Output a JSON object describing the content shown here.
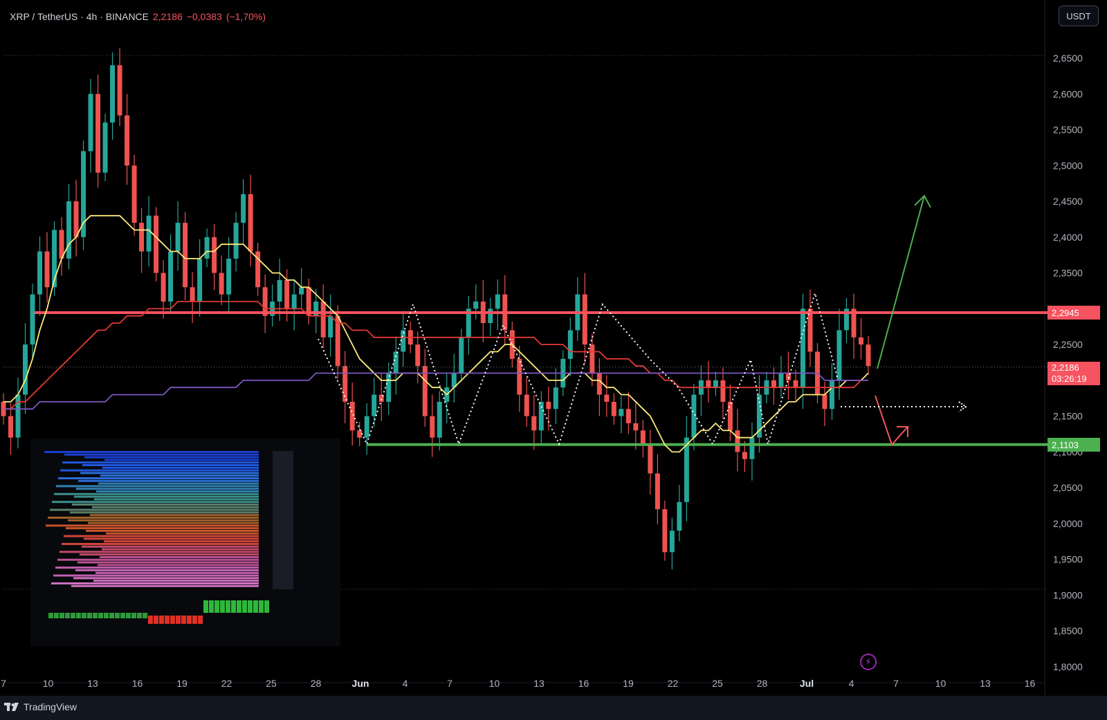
{
  "header": {
    "symbol": "XRP / TetherUS · 4h · BINANCE",
    "last": "2,2186",
    "change": "−0,0383",
    "change_pct": "(−1,70%)"
  },
  "currency": "USDT",
  "branding": "TradingView",
  "levels": {
    "resistance": {
      "value": 2.2945,
      "label": "2,2945",
      "color": "#f7525f"
    },
    "support": {
      "value": 2.1103,
      "label": "2,1103",
      "color": "#4caf50"
    },
    "last": {
      "value": 2.2186,
      "label": "2,2186",
      "countdown": "03:26:19",
      "color": "#f7525f"
    }
  },
  "colors": {
    "bull": "#26a69a",
    "bear": "#ef5350",
    "ma_fast": "#ffeb7a",
    "ma_mid": "#e53935",
    "ma_slow": "#7e57c2"
  },
  "chart_data": {
    "type": "line",
    "title": "XRP / TetherUS · 4h · BINANCE",
    "ylim": [
      1.8,
      2.65
    ],
    "y_ticks": [
      2.65,
      2.6,
      2.55,
      2.5,
      2.45,
      2.4,
      2.35,
      2.3,
      2.25,
      2.2,
      2.15,
      2.1,
      2.05,
      2.0,
      1.95,
      1.9,
      1.85,
      1.8
    ],
    "y_tick_labels": [
      "2,6500",
      "2,6000",
      "2,5500",
      "2,5000",
      "2,4500",
      "2,4000",
      "2,3500",
      "2,3000",
      "2,2500",
      "2,2000",
      "2,1500",
      "2,1000",
      "2,0500",
      "2,0000",
      "1,9500",
      "1,9000",
      "1,8500",
      "1,8000"
    ],
    "x_ticks": [
      "7",
      "10",
      "13",
      "16",
      "19",
      "22",
      "25",
      "28",
      "Jun",
      "4",
      "7",
      "10",
      "13",
      "16",
      "19",
      "22",
      "25",
      "28",
      "Jul",
      "4",
      "7",
      "10",
      "13",
      "16"
    ],
    "grid": false,
    "legend": "none",
    "series": [
      {
        "values": [
          2.15,
          2.12,
          2.18,
          2.25,
          2.32,
          2.38,
          2.33,
          2.41,
          2.37,
          2.45,
          2.4,
          2.52,
          2.6,
          2.49,
          2.56,
          2.64,
          2.57,
          2.5,
          2.42,
          2.38,
          2.43,
          2.35,
          2.31,
          2.38,
          2.42,
          2.33,
          2.31,
          2.37,
          2.4,
          2.35,
          2.32,
          2.37,
          2.42,
          2.46,
          2.38,
          2.33,
          2.29,
          2.31,
          2.34,
          2.3,
          2.32,
          2.33,
          2.29,
          2.31,
          2.26,
          2.29,
          2.22,
          2.17,
          2.13,
          2.12,
          2.15,
          2.18,
          2.17,
          2.21,
          2.24,
          2.27,
          2.25,
          2.22,
          2.15,
          2.12,
          2.17,
          2.19,
          2.21,
          2.26,
          2.3,
          2.31,
          2.28,
          2.3,
          2.32,
          2.27,
          2.23,
          2.18,
          2.15,
          2.13,
          2.17,
          2.16,
          2.19,
          2.23,
          2.27,
          2.32,
          2.25,
          2.21,
          2.18,
          2.17,
          2.15,
          2.16,
          2.14,
          2.13,
          2.11,
          2.07,
          2.02,
          1.96,
          1.99,
          2.03,
          2.12,
          2.18,
          2.2,
          2.19,
          2.2,
          2.17,
          2.13,
          2.1,
          2.09,
          2.12,
          2.18,
          2.2,
          2.19,
          2.21,
          2.2,
          2.19,
          2.3,
          2.24,
          2.18,
          2.16,
          2.2,
          2.27,
          2.3,
          2.26,
          2.25,
          2.22
        ]
      },
      {
        "values": [
          2.17,
          2.17,
          2.18,
          2.2,
          2.23,
          2.27,
          2.3,
          2.34,
          2.37,
          2.39,
          2.4,
          2.42,
          2.43,
          2.43,
          2.43,
          2.43,
          2.43,
          2.42,
          2.41,
          2.41,
          2.41,
          2.4,
          2.39,
          2.38,
          2.38,
          2.37,
          2.37,
          2.37,
          2.38,
          2.38,
          2.39,
          2.39,
          2.39,
          2.39,
          2.38,
          2.37,
          2.36,
          2.35,
          2.35,
          2.34,
          2.34,
          2.33,
          2.33,
          2.32,
          2.31,
          2.3,
          2.29,
          2.27,
          2.25,
          2.23,
          2.22,
          2.21,
          2.2,
          2.2,
          2.2,
          2.21,
          2.21,
          2.21,
          2.2,
          2.19,
          2.19,
          2.18,
          2.19,
          2.2,
          2.21,
          2.22,
          2.23,
          2.24,
          2.24,
          2.25,
          2.25,
          2.24,
          2.23,
          2.22,
          2.21,
          2.2,
          2.2,
          2.2,
          2.21,
          2.21,
          2.21,
          2.2,
          2.2,
          2.19,
          2.19,
          2.18,
          2.18,
          2.17,
          2.16,
          2.15,
          2.13,
          2.11,
          2.1,
          2.1,
          2.11,
          2.12,
          2.13,
          2.13,
          2.14,
          2.13,
          2.13,
          2.12,
          2.12,
          2.12,
          2.13,
          2.14,
          2.15,
          2.16,
          2.17,
          2.17,
          2.18,
          2.18,
          2.18,
          2.18,
          2.19,
          2.19,
          2.2,
          2.2,
          2.2,
          2.21
        ]
      },
      {
        "values": [
          2.16,
          2.16,
          2.17,
          2.17,
          2.18,
          2.19,
          2.2,
          2.21,
          2.22,
          2.23,
          2.24,
          2.25,
          2.26,
          2.27,
          2.27,
          2.28,
          2.28,
          2.29,
          2.29,
          2.29,
          2.3,
          2.3,
          2.3,
          2.3,
          2.31,
          2.31,
          2.31,
          2.31,
          2.31,
          2.31,
          2.31,
          2.31,
          2.31,
          2.31,
          2.31,
          2.31,
          2.3,
          2.3,
          2.3,
          2.3,
          2.3,
          2.3,
          2.29,
          2.29,
          2.29,
          2.29,
          2.28,
          2.28,
          2.27,
          2.27,
          2.27,
          2.26,
          2.26,
          2.26,
          2.26,
          2.26,
          2.26,
          2.26,
          2.26,
          2.26,
          2.26,
          2.26,
          2.26,
          2.26,
          2.26,
          2.26,
          2.26,
          2.26,
          2.26,
          2.26,
          2.26,
          2.26,
          2.26,
          2.26,
          2.25,
          2.25,
          2.25,
          2.25,
          2.24,
          2.24,
          2.24,
          2.24,
          2.24,
          2.23,
          2.23,
          2.23,
          2.23,
          2.22,
          2.22,
          2.21,
          2.21,
          2.2,
          2.2,
          2.19,
          2.19,
          2.19,
          2.19,
          2.19,
          2.19,
          2.19,
          2.19,
          2.19,
          2.19,
          2.19,
          2.19,
          2.19,
          2.19,
          2.19,
          2.19,
          2.19,
          2.19,
          2.19,
          2.19,
          2.19,
          2.19,
          2.19,
          2.19,
          2.19,
          2.2,
          2.2
        ]
      },
      {
        "values": [
          2.16,
          2.16,
          2.16,
          2.16,
          2.16,
          2.17,
          2.17,
          2.17,
          2.17,
          2.17,
          2.17,
          2.17,
          2.17,
          2.17,
          2.17,
          2.18,
          2.18,
          2.18,
          2.18,
          2.18,
          2.18,
          2.18,
          2.18,
          2.19,
          2.19,
          2.19,
          2.19,
          2.19,
          2.19,
          2.19,
          2.19,
          2.19,
          2.19,
          2.2,
          2.2,
          2.2,
          2.2,
          2.2,
          2.2,
          2.2,
          2.2,
          2.2,
          2.2,
          2.21,
          2.21,
          2.21,
          2.21,
          2.21,
          2.21,
          2.21,
          2.21,
          2.21,
          2.21,
          2.21,
          2.21,
          2.21,
          2.21,
          2.21,
          2.21,
          2.21,
          2.21,
          2.21,
          2.21,
          2.21,
          2.21,
          2.21,
          2.21,
          2.21,
          2.21,
          2.21,
          2.21,
          2.21,
          2.21,
          2.21,
          2.21,
          2.21,
          2.21,
          2.21,
          2.21,
          2.21,
          2.21,
          2.21,
          2.21,
          2.21,
          2.21,
          2.21,
          2.21,
          2.21,
          2.21,
          2.21,
          2.21,
          2.21,
          2.21,
          2.21,
          2.21,
          2.21,
          2.21,
          2.21,
          2.21,
          2.21,
          2.21,
          2.21,
          2.21,
          2.21,
          2.21,
          2.21,
          2.21,
          2.21,
          2.21,
          2.21,
          2.21,
          2.21,
          2.21,
          2.2,
          2.2,
          2.2,
          2.2,
          2.2,
          2.2,
          2.2
        ]
      }
    ]
  }
}
